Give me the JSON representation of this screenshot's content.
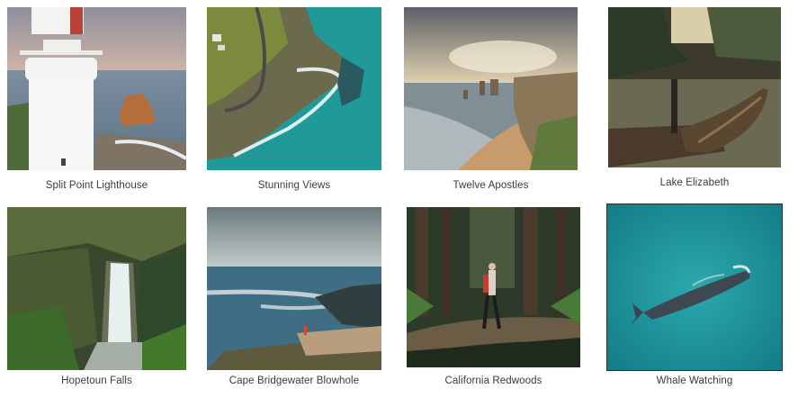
{
  "gallery": {
    "items": [
      {
        "caption": "Split Point Lighthouse",
        "image": "lighthouse-photo"
      },
      {
        "caption": "Stunning Views",
        "image": "aerial-coast-photo"
      },
      {
        "caption": "Twelve Apostles",
        "image": "sea-stacks-photo"
      },
      {
        "caption": "Lake Elizabeth",
        "image": "canoe-lake-photo"
      },
      {
        "caption": "Hopetoun Falls",
        "image": "waterfall-photo"
      },
      {
        "caption": "Cape Bridgewater Blowhole",
        "image": "cliff-ocean-photo"
      },
      {
        "caption": "California Redwoods",
        "image": "forest-hiker-photo"
      },
      {
        "caption": "Whale Watching",
        "image": "whale-photo"
      }
    ]
  }
}
